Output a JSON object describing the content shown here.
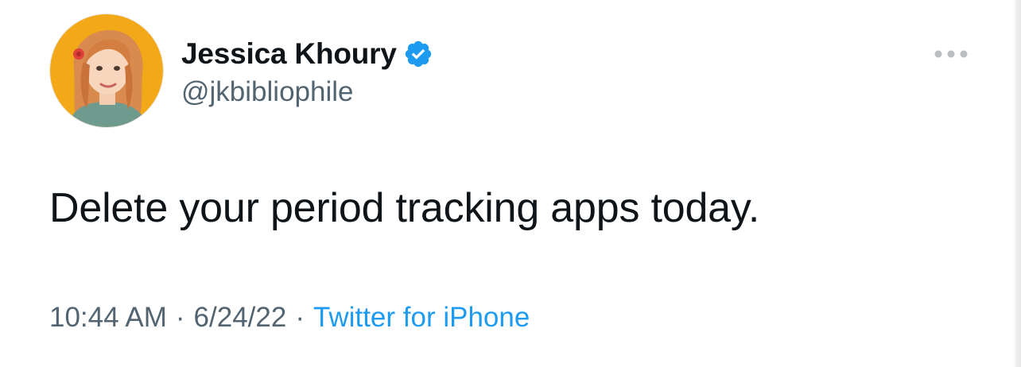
{
  "author": {
    "display_name": "Jessica Khoury",
    "handle": "@jkbibliophile",
    "verified_icon": "verified-badge-icon",
    "avatar_icon": "profile-avatar"
  },
  "tweet": {
    "text": "Delete your period tracking apps today."
  },
  "meta": {
    "time": "10:44 AM",
    "separator": "·",
    "date": "6/24/22",
    "source": "Twitter for iPhone"
  },
  "more_icon": "more-options-icon",
  "colors": {
    "primary_text": "#0f1419",
    "secondary_text": "#536471",
    "link_blue": "#1d9bf0",
    "verified_blue": "#1d9bf0",
    "more_dots": "#b9bec3"
  }
}
